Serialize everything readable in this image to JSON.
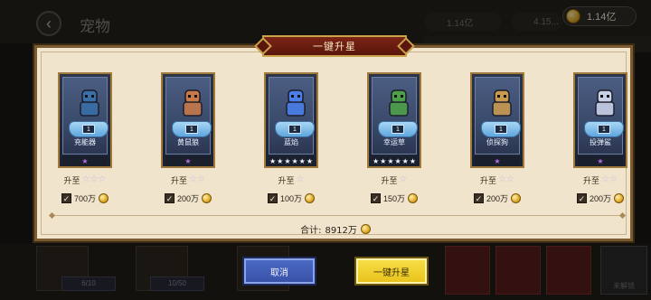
{
  "background": {
    "title": "宠物",
    "balances": [
      "1.14亿",
      "4.15..."
    ],
    "bottom_bars": [
      "6/10",
      "10/50"
    ],
    "lock_label": "未解锁"
  },
  "currency": {
    "label": "1.14亿",
    "icon": "gold-coin-icon"
  },
  "dialog": {
    "title": "一键升星",
    "upgrade_label": "升至",
    "pets": [
      {
        "name": "充能器",
        "level": "1",
        "card_stars": 1,
        "target_stars": "☆☆☆",
        "cost": "700万",
        "checked": true,
        "figure": "robot",
        "color": "#3a6ea8"
      },
      {
        "name": "黄鼠狼",
        "level": "1",
        "card_stars": 1,
        "target_stars": "☆☆",
        "cost": "200万",
        "checked": true,
        "figure": "beast",
        "color": "#c67a4a"
      },
      {
        "name": "蓝焰",
        "level": "1",
        "card_stars": 6,
        "target_stars": "☆",
        "cost": "100万",
        "checked": true,
        "figure": "flame",
        "color": "#4a7ee8"
      },
      {
        "name": "幸运草",
        "level": "1",
        "card_stars": 6,
        "target_stars": "☆",
        "cost": "150万",
        "checked": true,
        "figure": "clover",
        "color": "#4da04a"
      },
      {
        "name": "侦探狗",
        "level": "1",
        "card_stars": 1,
        "target_stars": "☆☆",
        "cost": "200万",
        "checked": true,
        "figure": "dog",
        "color": "#c89a50"
      },
      {
        "name": "投弹鲨",
        "level": "1",
        "card_stars": 1,
        "target_stars": "☆☆",
        "cost": "200万",
        "checked": true,
        "figure": "shark",
        "color": "#c8d0e8"
      }
    ],
    "total_label": "合计:",
    "total_value": "8912万",
    "cancel_label": "取消",
    "confirm_label": "一键升星"
  },
  "colors": {
    "accent": "#7b2416",
    "card_gold": "#a07a3c",
    "purple_star": "#b56ee6"
  }
}
